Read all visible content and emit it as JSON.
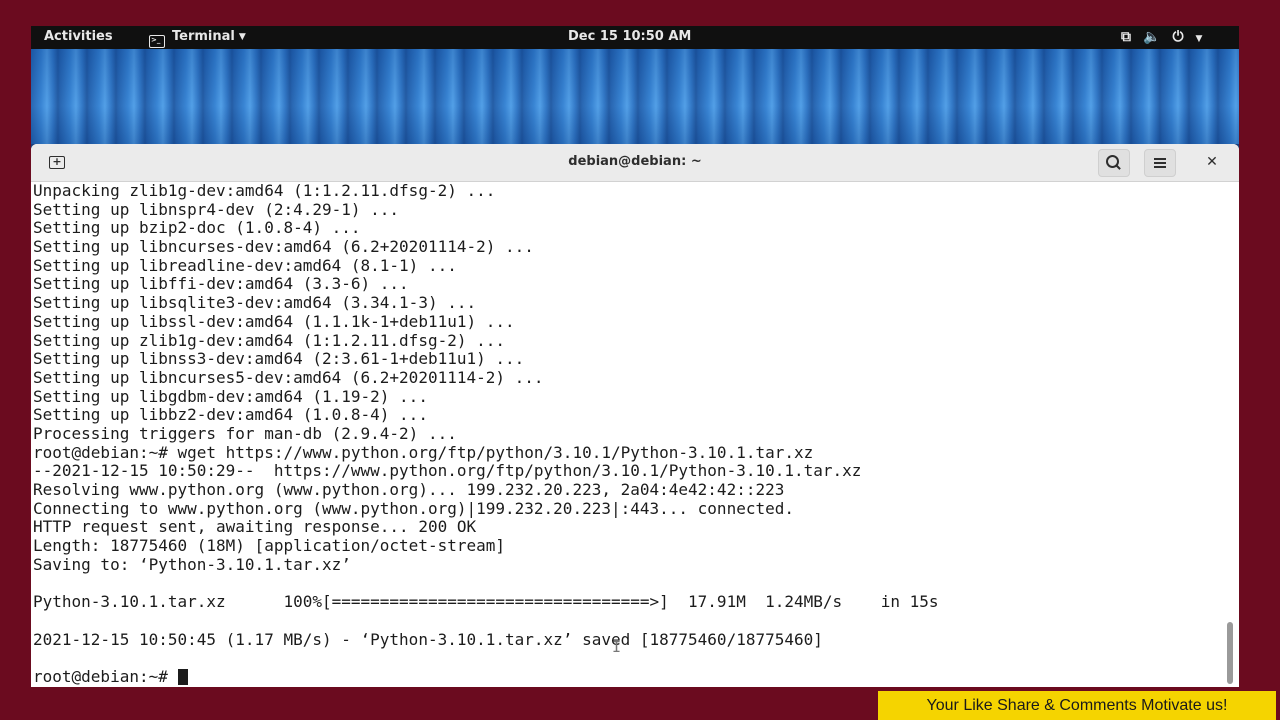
{
  "topbar": {
    "activities": "Activities",
    "app_menu": "Terminal",
    "clock": "Dec 15  10:50 AM"
  },
  "window": {
    "title": "debian@debian: ~"
  },
  "terminal": {
    "lines": [
      "Unpacking zlib1g-dev:amd64 (1:1.2.11.dfsg-2) ...",
      "Setting up libnspr4-dev (2:4.29-1) ...",
      "Setting up bzip2-doc (1.0.8-4) ...",
      "Setting up libncurses-dev:amd64 (6.2+20201114-2) ...",
      "Setting up libreadline-dev:amd64 (8.1-1) ...",
      "Setting up libffi-dev:amd64 (3.3-6) ...",
      "Setting up libsqlite3-dev:amd64 (3.34.1-3) ...",
      "Setting up libssl-dev:amd64 (1.1.1k-1+deb11u1) ...",
      "Setting up zlib1g-dev:amd64 (1:1.2.11.dfsg-2) ...",
      "Setting up libnss3-dev:amd64 (2:3.61-1+deb11u1) ...",
      "Setting up libncurses5-dev:amd64 (6.2+20201114-2) ...",
      "Setting up libgdbm-dev:amd64 (1.19-2) ...",
      "Setting up libbz2-dev:amd64 (1.0.8-4) ...",
      "Processing triggers for man-db (2.9.4-2) ...",
      "root@debian:~# wget https://www.python.org/ftp/python/3.10.1/Python-3.10.1.tar.xz",
      "--2021-12-15 10:50:29--  https://www.python.org/ftp/python/3.10.1/Python-3.10.1.tar.xz",
      "Resolving www.python.org (www.python.org)... 199.232.20.223, 2a04:4e42:42::223",
      "Connecting to www.python.org (www.python.org)|199.232.20.223|:443... connected.",
      "HTTP request sent, awaiting response... 200 OK",
      "Length: 18775460 (18M) [application/octet-stream]",
      "Saving to: ‘Python-3.10.1.tar.xz’",
      "",
      "Python-3.10.1.tar.xz      100%[=================================>]  17.91M  1.24MB/s    in 15s",
      "",
      "2021-12-15 10:50:45 (1.17 MB/s) - ‘Python-3.10.1.tar.xz’ saved [18775460/18775460]",
      ""
    ],
    "prompt": "root@debian:~# "
  },
  "banner": {
    "text": "Your Like Share & Comments Motivate us!"
  },
  "colors": {
    "border": "#6b0b1f",
    "banner": "#f5d400",
    "topbar": "#101010"
  }
}
